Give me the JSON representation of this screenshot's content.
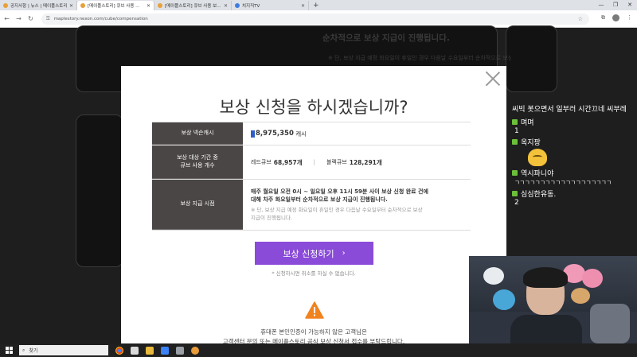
{
  "browser": {
    "tabs": [
      {
        "label": "공지사항 | 뉴스 | 메이플스토리",
        "active": false
      },
      {
        "label": "[메이플스토리] 큐브 사용 ...",
        "active": true
      },
      {
        "label": "[메이플스토리] 큐브 사용 보...",
        "active": false
      },
      {
        "label": "치지직TV",
        "active": false
      }
    ],
    "new_tab": "+",
    "url": "maplestory.nexon.com/cube/compensation"
  },
  "background": {
    "text1": "순차적으로 보상 지급이 진행됩니다.",
    "text2": "※ 단, 보상 지급 예정 화요일이 휴일인 경우 다음날 수요일부터 순차적으로 보상 지급이 진행됩니다."
  },
  "modal": {
    "title": "보상 신청을 하시겠습니까?",
    "rows": {
      "reward_label": "보상 넥슨캐시",
      "reward_value": "8,975,350",
      "reward_unit": "캐시",
      "usage_label_1": "보상 대상 기간 중",
      "usage_label_2": "큐브 사용 개수",
      "red_cube_label": "레드큐브",
      "red_cube_value": "68,957개",
      "black_cube_label": "블랙큐브",
      "black_cube_value": "128,291개",
      "schedule_label": "보상 지급 시점",
      "schedule_text_1": "매주 월요일 오전 0시 ~ 일요일 오후 11시 59분 사이 보상 신청 완료 건에",
      "schedule_text_2": "대해 차주 화요일부터 순차적으로 보상 지급이 진행됩니다.",
      "schedule_note_1": "※ 단, 보상 지급 예정 화요일이 휴일인 경우 다음날 수요일부터 순차적으로 보상",
      "schedule_note_2": "지급이 진행됩니다."
    },
    "apply_button": "보상 신청하기",
    "apply_note": "* 신청하시면 취소를 하실 수 없습니다.",
    "warning_1": "휴대폰 본인인증이 가능하지 않은 고객님은",
    "warning_2": "고객센터 문의 또는 메이플스토리 공식 보상 신청서 접수를 부탁드립니다."
  },
  "chat": {
    "top_message": "씨빅 봇으면서 일부러 시간끄네 씨부레",
    "messages": [
      {
        "user": "며며",
        "text": "1"
      },
      {
        "user": "옥지팡",
        "text": ""
      },
      {
        "user": "역시파니야",
        "text": "ㄱㄱㄱㄱㄱㄱㄱㄱㄱㄱㄱㄱㄱㄱㄱㄱㄱㄱㄱ"
      },
      {
        "user": "심심한유동.",
        "text": "2"
      }
    ],
    "badge_color": "#6bbf3a"
  },
  "taskbar": {
    "search_placeholder": "찾기"
  },
  "colors": {
    "accent_button": "#8a4bd8",
    "table_header": "#4b4646",
    "warning": "#f0831e"
  }
}
